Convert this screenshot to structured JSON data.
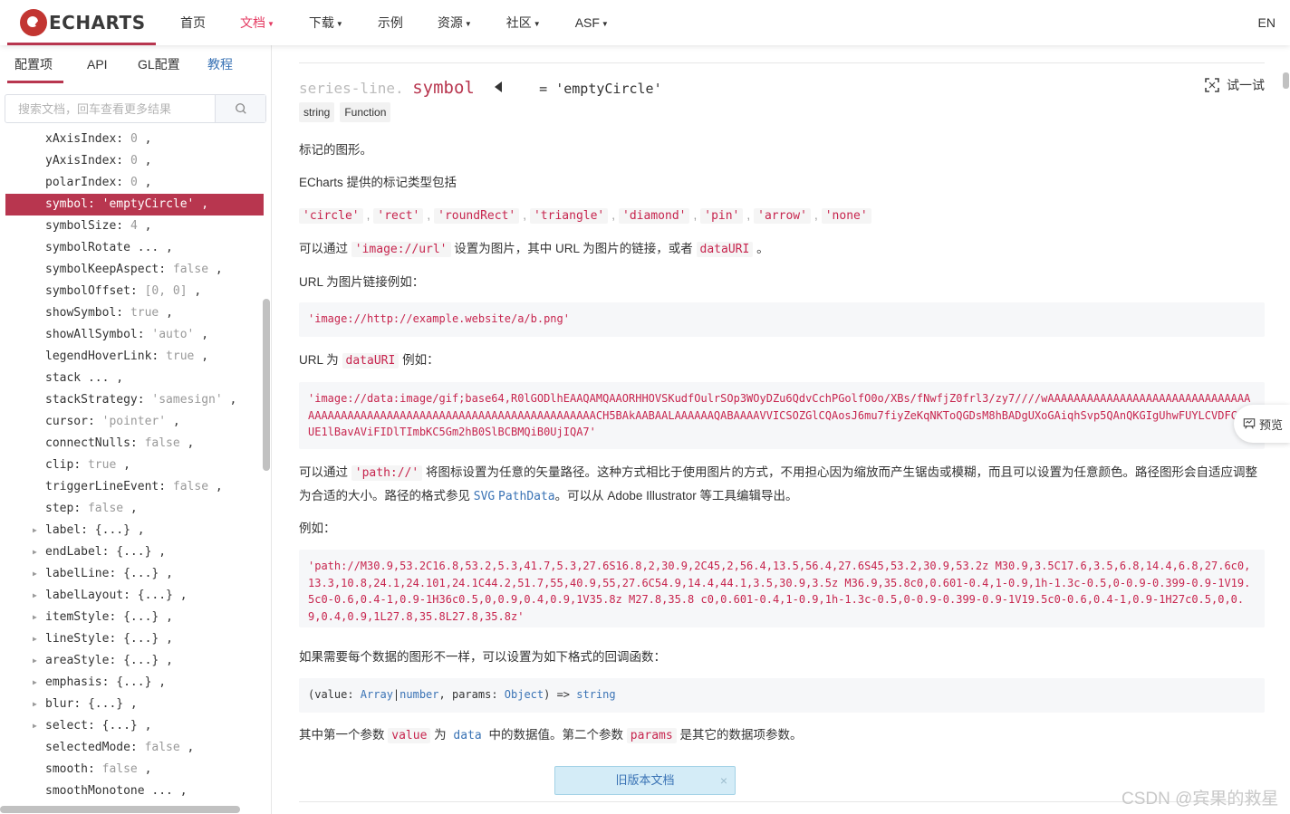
{
  "navbar": {
    "logo_text": "ECHARTS",
    "items": [
      {
        "label": "首页",
        "dropdown": false,
        "active": false
      },
      {
        "label": "文档",
        "dropdown": true,
        "active": true
      },
      {
        "label": "下载",
        "dropdown": true,
        "active": false
      },
      {
        "label": "示例",
        "dropdown": false,
        "active": false
      },
      {
        "label": "资源",
        "dropdown": true,
        "active": false
      },
      {
        "label": "社区",
        "dropdown": true,
        "active": false
      },
      {
        "label": "ASF",
        "dropdown": true,
        "active": false
      }
    ],
    "caret": "▼",
    "lang": "EN"
  },
  "sidebar": {
    "tabs": [
      "配置项",
      "API",
      "GL配置",
      "教程"
    ],
    "search_placeholder": "搜索文档，回车查看更多结果",
    "items": [
      {
        "key": "xAxisIndex",
        "value": "0",
        "expandable": false
      },
      {
        "key": "yAxisIndex",
        "value": "0",
        "expandable": false
      },
      {
        "key": "polarIndex",
        "value": "0",
        "expandable": false
      },
      {
        "key": "symbol",
        "value": "'emptyCircle'",
        "expandable": false,
        "selected": true
      },
      {
        "key": "symbolSize",
        "value": "4",
        "expandable": false
      },
      {
        "key": "symbolRotate",
        "value": "...",
        "expandable": false,
        "ellipsis": true
      },
      {
        "key": "symbolKeepAspect",
        "value": "false",
        "expandable": false
      },
      {
        "key": "symbolOffset",
        "value": "[0, 0]",
        "expandable": false
      },
      {
        "key": "showSymbol",
        "value": "true",
        "expandable": false
      },
      {
        "key": "showAllSymbol",
        "value": "'auto'",
        "expandable": false
      },
      {
        "key": "legendHoverLink",
        "value": "true",
        "expandable": false
      },
      {
        "key": "stack",
        "value": "...",
        "expandable": false,
        "ellipsis": true
      },
      {
        "key": "stackStrategy",
        "value": "'samesign'",
        "expandable": false
      },
      {
        "key": "cursor",
        "value": "'pointer'",
        "expandable": false
      },
      {
        "key": "connectNulls",
        "value": "false",
        "expandable": false
      },
      {
        "key": "clip",
        "value": "true",
        "expandable": false
      },
      {
        "key": "triggerLineEvent",
        "value": "false",
        "expandable": false
      },
      {
        "key": "step",
        "value": "false",
        "expandable": false
      },
      {
        "key": "label",
        "value": "{...}",
        "expandable": true
      },
      {
        "key": "endLabel",
        "value": "{...}",
        "expandable": true
      },
      {
        "key": "labelLine",
        "value": "{...}",
        "expandable": true
      },
      {
        "key": "labelLayout",
        "value": "{...}",
        "expandable": true
      },
      {
        "key": "itemStyle",
        "value": "{...}",
        "expandable": true
      },
      {
        "key": "lineStyle",
        "value": "{...}",
        "expandable": true
      },
      {
        "key": "areaStyle",
        "value": "{...}",
        "expandable": true
      },
      {
        "key": "emphasis",
        "value": "{...}",
        "expandable": true
      },
      {
        "key": "blur",
        "value": "{...}",
        "expandable": true
      },
      {
        "key": "select",
        "value": "{...}",
        "expandable": true
      },
      {
        "key": "selectedMode",
        "value": "false",
        "expandable": false
      },
      {
        "key": "smooth",
        "value": "false",
        "expandable": false
      },
      {
        "key": "smoothMonotone",
        "value": "...",
        "expandable": false,
        "ellipsis": true
      }
    ]
  },
  "doc": {
    "title_prefix": "series-line.",
    "title_name": "symbol",
    "title_default": "= 'emptyCircle'",
    "try_label": "试一试",
    "types": [
      "string",
      "Function"
    ],
    "p1": "标记的图形。",
    "p2": "ECharts 提供的标记类型包括",
    "symbol_types": [
      "'circle'",
      "'rect'",
      "'roundRect'",
      "'triangle'",
      "'diamond'",
      "'pin'",
      "'arrow'",
      "'none'"
    ],
    "symbol_sep": ",",
    "p3_a": "可以通过 ",
    "p3_code1": "'image://url'",
    "p3_b": " 设置为图片，其中 URL 为图片的链接，或者 ",
    "p3_code2": "dataURI",
    "p3_c": " 。",
    "p4": "URL 为图片链接例如：",
    "code1": "'image://http://example.website/a/b.png'",
    "p5_a": "URL 为 ",
    "p5_code": "dataURI",
    "p5_b": " 例如：",
    "code2": "'image://data:image/gif;base64,R0lGODlhEAAQAMQAAORHHOVSKudfOulrSOp3WOyDZu6QdvCchPGolfO0o/XBs/fNwfjZ0frl3/zy7////wAAAAAAAAAAAAAAAAAAAAAAAAAAAAAAAAAAAAAAAAAAAAAAAAAAAAAAAAAAAAAAAAAAAAAAAAAAACH5BAkAABAALAAAAAAQABAAAAVVICSOZGlCQAosJ6mu7fiyZeKqNKToQGDsM8hBADgUXoGAiqhSvp5QAnQKGIgUhwFUYLCVDFCrKUE1lBavAViFIDlTImbKC5Gm2hB0SlBCBMQiB0UjIQA7'",
    "p6_a": "可以通过 ",
    "p6_code": "'path://'",
    "p6_b": " 将图标设置为任意的矢量路径。这种方式相比于使用图片的方式，不用担心因为缩放而产生锯齿或模糊，而且可以设置为任意颜色。路径图形会自适应调整为合适的大小。路径的格式参见 ",
    "p6_link1": "SVG",
    "p6_link2": "PathData",
    "p6_c": "。可以从 Adobe Illustrator 等工具编辑导出。",
    "p7": "例如：",
    "code3": "'path://M30.9,53.2C16.8,53.2,5.3,41.7,5.3,27.6S16.8,2,30.9,2C45,2,56.4,13.5,56.4,27.6S45,53.2,30.9,53.2z M30.9,3.5C17.6,3.5,6.8,14.4,6.8,27.6c0,13.3,10.8,24.1,24.101,24.1C44.2,51.7,55,40.9,55,27.6C54.9,14.4,44.1,3.5,30.9,3.5z M36.9,35.8c0,0.601-0.4,1-0.9,1h-1.3c-0.5,0-0.9-0.399-0.9-1V19.5c0-0.6,0.4-1,0.9-1H36c0.5,0,0.9,0.4,0.9,1V35.8z M27.8,35.8 c0,0.601-0.4,1-0.9,1h-1.3c-0.5,0-0.9-0.399-0.9-1V19.5c0-0.6,0.4-1,0.9-1H27c0.5,0,0.9,0.4,0.9,1L27.8,35.8L27.8,35.8z'",
    "p8": "如果需要每个数据的图形不一样，可以设置为如下格式的回调函数：",
    "code4": {
      "a": "(value: ",
      "t1": "Array",
      "b": "|",
      "t2": "number",
      "c": ", params: ",
      "t3": "Object",
      "d": ") => ",
      "t4": "string"
    },
    "p9_a": "其中第一个参数 ",
    "p9_code1": "value",
    "p9_b": " 为 ",
    "p9_code2": "data",
    "p9_c": " 中的数据值。第二个参数 ",
    "p9_code3": "params",
    "p9_d": " 是其它的数据项参数。",
    "old_doc_label": "旧版本文档",
    "old_doc_close": "×"
  },
  "preview_label": "预览",
  "watermark": "CSDN @宾果的救星"
}
